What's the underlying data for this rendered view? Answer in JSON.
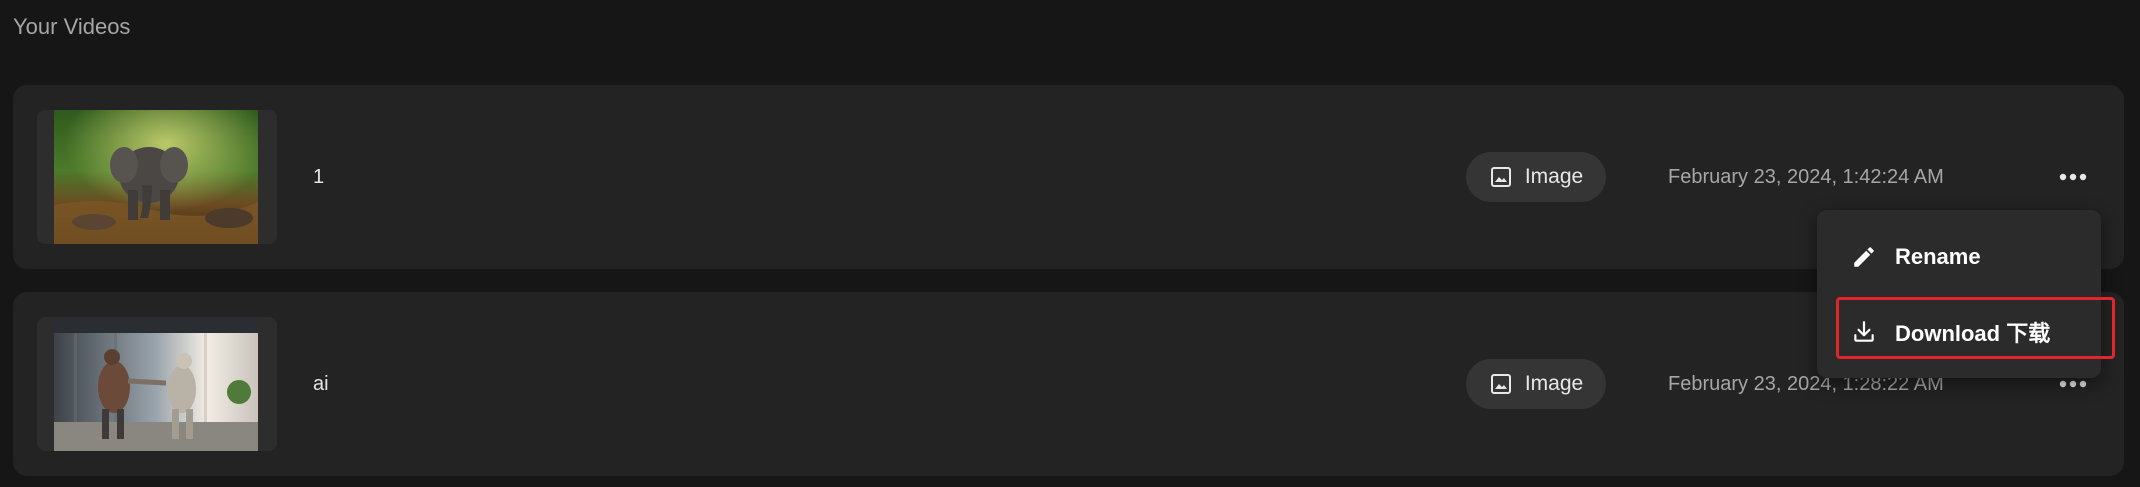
{
  "section_title": "Your Videos",
  "videos": [
    {
      "name": "1",
      "type_label": "Image",
      "date": "February 23, 2024, 1:42:24 AM",
      "thumbnail_icon": "elephant-thumbnail"
    },
    {
      "name": "ai",
      "type_label": "Image",
      "date": "February 23, 2024, 1:28:22 AM",
      "thumbnail_icon": "robots-fighting-thumbnail"
    }
  ],
  "context_menu": {
    "rename_label": "Rename",
    "download_label": "Download 下载",
    "rename_icon": "pencil-icon",
    "download_icon": "download-icon",
    "highlight_color": "#e0262a"
  },
  "icons": {
    "type_icon": "image-icon",
    "more_icon": "more-horizontal-icon"
  }
}
